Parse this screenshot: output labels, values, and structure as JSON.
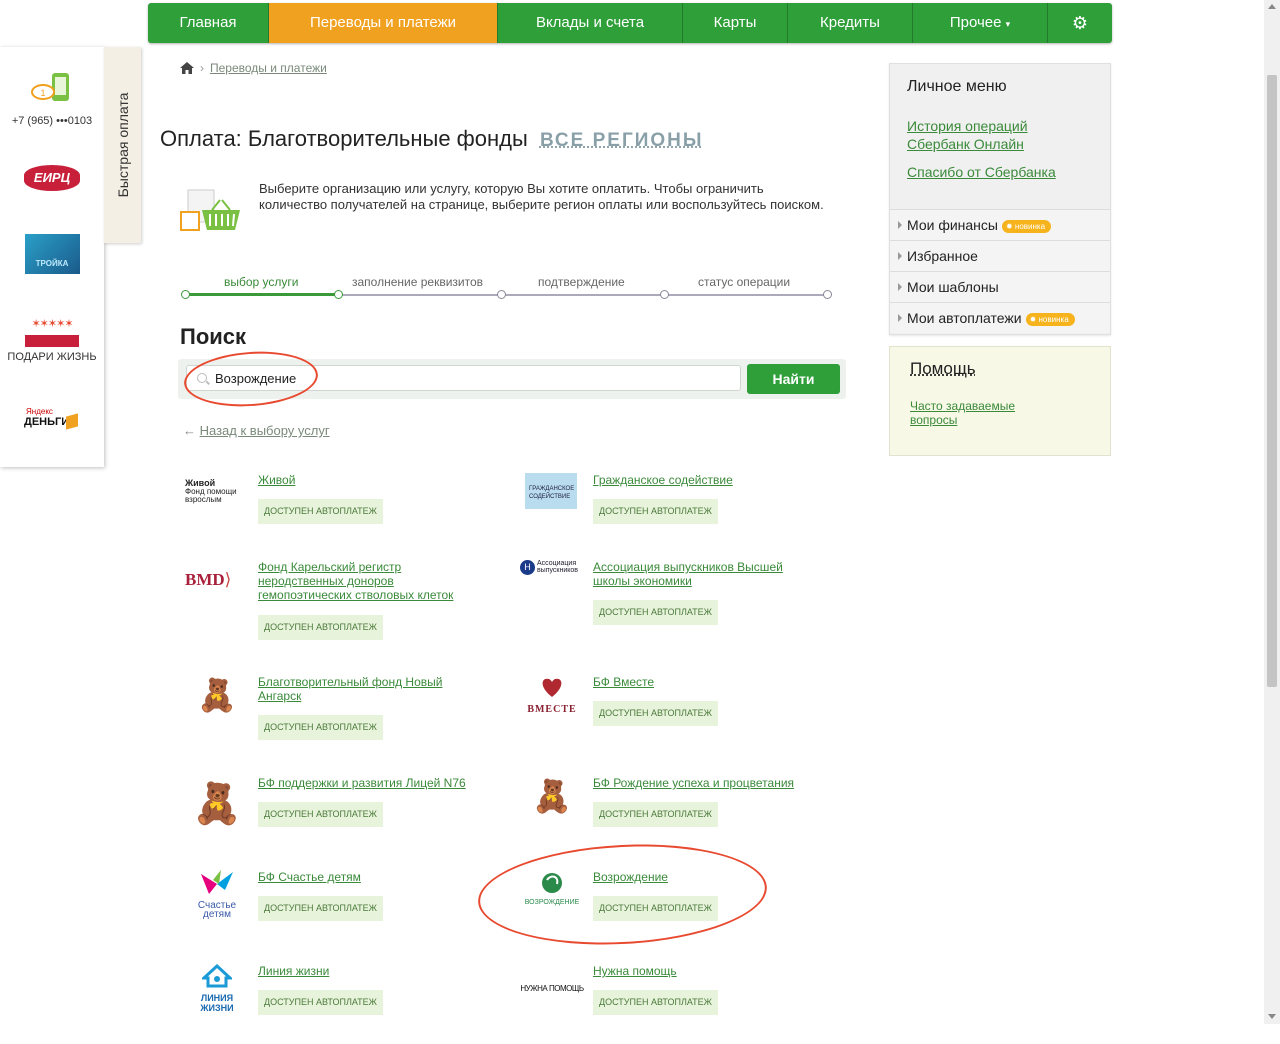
{
  "nav": {
    "items": [
      "Главная",
      "Переводы и платежи",
      "Вклады и счета",
      "Карты",
      "Кредиты",
      "Прочее"
    ],
    "active": 1
  },
  "quickpay": {
    "tab_label": "Быстрая оплата",
    "phone": "+7 (965) •••0103",
    "emr_logo": "ЕИРЦ",
    "troika_logo": "ТРОЙКА",
    "gift_label": "ПОДАРИ ЖИЗНЬ",
    "yandex_top": "Яндекс",
    "yandex_bottom": "ДЕНЬГИ"
  },
  "breadcrumb": {
    "link": "Переводы и платежи"
  },
  "page": {
    "title": "Оплата: Благотворительные фонды",
    "regions": "ВСЕ РЕГИОНЫ",
    "intro": "Выберите организацию или услугу, которую Вы хотите оплатить. Чтобы ограничить количество получателей на странице, выберите регион оплаты или воспользуйтесь поиском."
  },
  "steps": [
    "выбор услуги",
    "заполнение реквизитов",
    "подтверждение",
    "статус операции"
  ],
  "search": {
    "title": "Поиск",
    "value": "Возрождение",
    "button": "Найти"
  },
  "back_link": "Назад к выбору услуг",
  "badge_label": "ДОСТУПЕН АВТОПЛАТЕЖ",
  "services": [
    {
      "name": "Живой",
      "logo": "Живой Фонд помощи взрослым"
    },
    {
      "name": "Гражданское содействие",
      "logo": "ГРАЖДАНСКОЕ СОДЕЙСТВИЕ"
    },
    {
      "name": "Фонд Карельский регистр неродственных доноров гемопоэтических стволовых клеток",
      "logo": "BMD"
    },
    {
      "name": "Ассоциация выпускников Высшей школы экономики",
      "logo": "Ассоциация выпускников"
    },
    {
      "name": "Благотворительный фонд Новый Ангарск",
      "logo": ""
    },
    {
      "name": "БФ Вместе",
      "logo": "ВМЕСТЕ"
    },
    {
      "name": "БФ поддержки и развития Лицей N76",
      "logo": ""
    },
    {
      "name": "БФ Рождение успеха и процветания",
      "logo": ""
    },
    {
      "name": "БФ Счастье детям",
      "logo": "Счастье детям"
    },
    {
      "name": "Возрождение",
      "logo": "ВОЗРОЖДЕНИЕ"
    },
    {
      "name": "Линия жизни",
      "logo": "ЛИНИЯ ЖИЗНИ"
    },
    {
      "name": "Нужна помощь",
      "logo": "НУЖНА ПОМОЩЬ"
    }
  ],
  "personal_menu": {
    "title": "Личное меню",
    "link1": "История операций Сбербанк Онлайн",
    "link2": "Спасибо от Сбербанка",
    "rows": [
      "Мои финансы",
      "Избранное",
      "Мои шаблоны",
      "Мои автоплатежи"
    ],
    "new_label": "новинка"
  },
  "help": {
    "title": "Помощь",
    "link": "Часто задаваемые вопросы"
  },
  "colors": {
    "brand_green": "#2f9f3a",
    "active_orange": "#f0a11f",
    "annotation_red": "#e84a30"
  }
}
